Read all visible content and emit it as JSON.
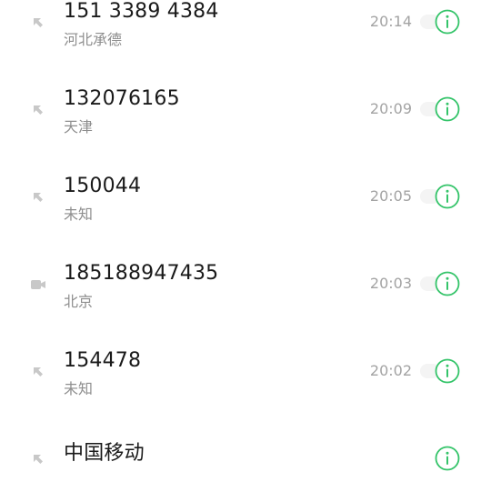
{
  "calls": [
    {
      "name": "151 3389 4384",
      "location": "河北承德",
      "time": "20:14",
      "type": "outgoing",
      "icon": "outgoing-call-icon"
    },
    {
      "name": "132076165",
      "location": "天津",
      "time": "20:09",
      "type": "outgoing",
      "icon": "outgoing-call-icon"
    },
    {
      "name": "150044",
      "location": "未知",
      "time": "20:05",
      "type": "outgoing",
      "icon": "outgoing-call-icon"
    },
    {
      "name": "185188947435",
      "location": "北京",
      "time": "20:03",
      "type": "video",
      "icon": "video-call-icon"
    },
    {
      "name": "154478",
      "location": "未知",
      "time": "20:02",
      "type": "outgoing",
      "icon": "outgoing-call-icon"
    },
    {
      "name": "中国移动",
      "location": "",
      "time": "",
      "type": "outgoing",
      "icon": "outgoing-call-icon"
    }
  ],
  "colors": {
    "accent": "#35c46a",
    "primary_text": "#1a1a1a",
    "secondary_text": "#8e8e8e",
    "time_text": "#a3a3a3",
    "icon_gray": "#c8c8c8"
  }
}
